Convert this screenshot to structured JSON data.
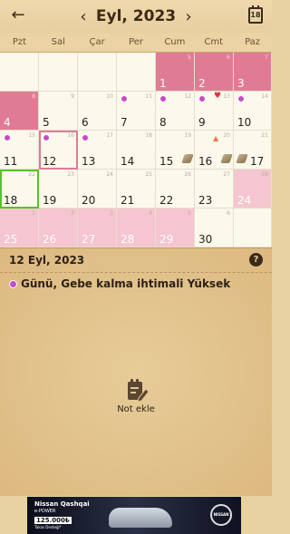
{
  "header": {
    "month_title": "Eyl, 2023",
    "calendar_icon_day": "18"
  },
  "weekdays": [
    "Pzt",
    "Sal",
    "Çar",
    "Per",
    "Cum",
    "Cmt",
    "Paz"
  ],
  "calendar": {
    "cells": [
      {
        "num": "",
        "small": ""
      },
      {
        "num": "",
        "small": ""
      },
      {
        "num": "",
        "small": ""
      },
      {
        "num": "",
        "small": ""
      },
      {
        "num": "1",
        "small": "5"
      },
      {
        "num": "2",
        "small": "6"
      },
      {
        "num": "3",
        "small": "7"
      },
      {
        "num": "4",
        "small": "8"
      },
      {
        "num": "5",
        "small": "9"
      },
      {
        "num": "6",
        "small": "10"
      },
      {
        "num": "7",
        "small": "11"
      },
      {
        "num": "8",
        "small": "12"
      },
      {
        "num": "9",
        "small": "13"
      },
      {
        "num": "10",
        "small": "14"
      },
      {
        "num": "11",
        "small": "15"
      },
      {
        "num": "12",
        "small": "16"
      },
      {
        "num": "13",
        "small": "17"
      },
      {
        "num": "14",
        "small": "18"
      },
      {
        "num": "15",
        "small": "19"
      },
      {
        "num": "16",
        "small": "20"
      },
      {
        "num": "17",
        "small": "21"
      },
      {
        "num": "18",
        "small": "22"
      },
      {
        "num": "19",
        "small": "23"
      },
      {
        "num": "20",
        "small": "24"
      },
      {
        "num": "21",
        "small": "25"
      },
      {
        "num": "22",
        "small": "26"
      },
      {
        "num": "23",
        "small": "27"
      },
      {
        "num": "24",
        "small": "28"
      },
      {
        "num": "25",
        "small": "1"
      },
      {
        "num": "26",
        "small": "2"
      },
      {
        "num": "27",
        "small": "3"
      },
      {
        "num": "28",
        "small": "4"
      },
      {
        "num": "29",
        "small": "5"
      },
      {
        "num": "30",
        "small": "6"
      },
      {
        "num": "",
        "small": ""
      }
    ]
  },
  "detail": {
    "date_title": "12 Eyl, 2023",
    "fertility_text": "Günü, Gebe kalma ihtimali Yüksek",
    "note_label": "Not ekle"
  },
  "ad": {
    "line1": "Nissan Qashqai",
    "line2": "e-POWER",
    "line3": "125.000₺",
    "line4": "Takas Desteği*",
    "brand": "NISSAN"
  },
  "colors": {
    "period": "#e07b95",
    "predicted": "#f5c5d0",
    "selected_border": "#e07b95",
    "today_border": "#58c22a",
    "fertility_dot": "#c84ac5"
  }
}
